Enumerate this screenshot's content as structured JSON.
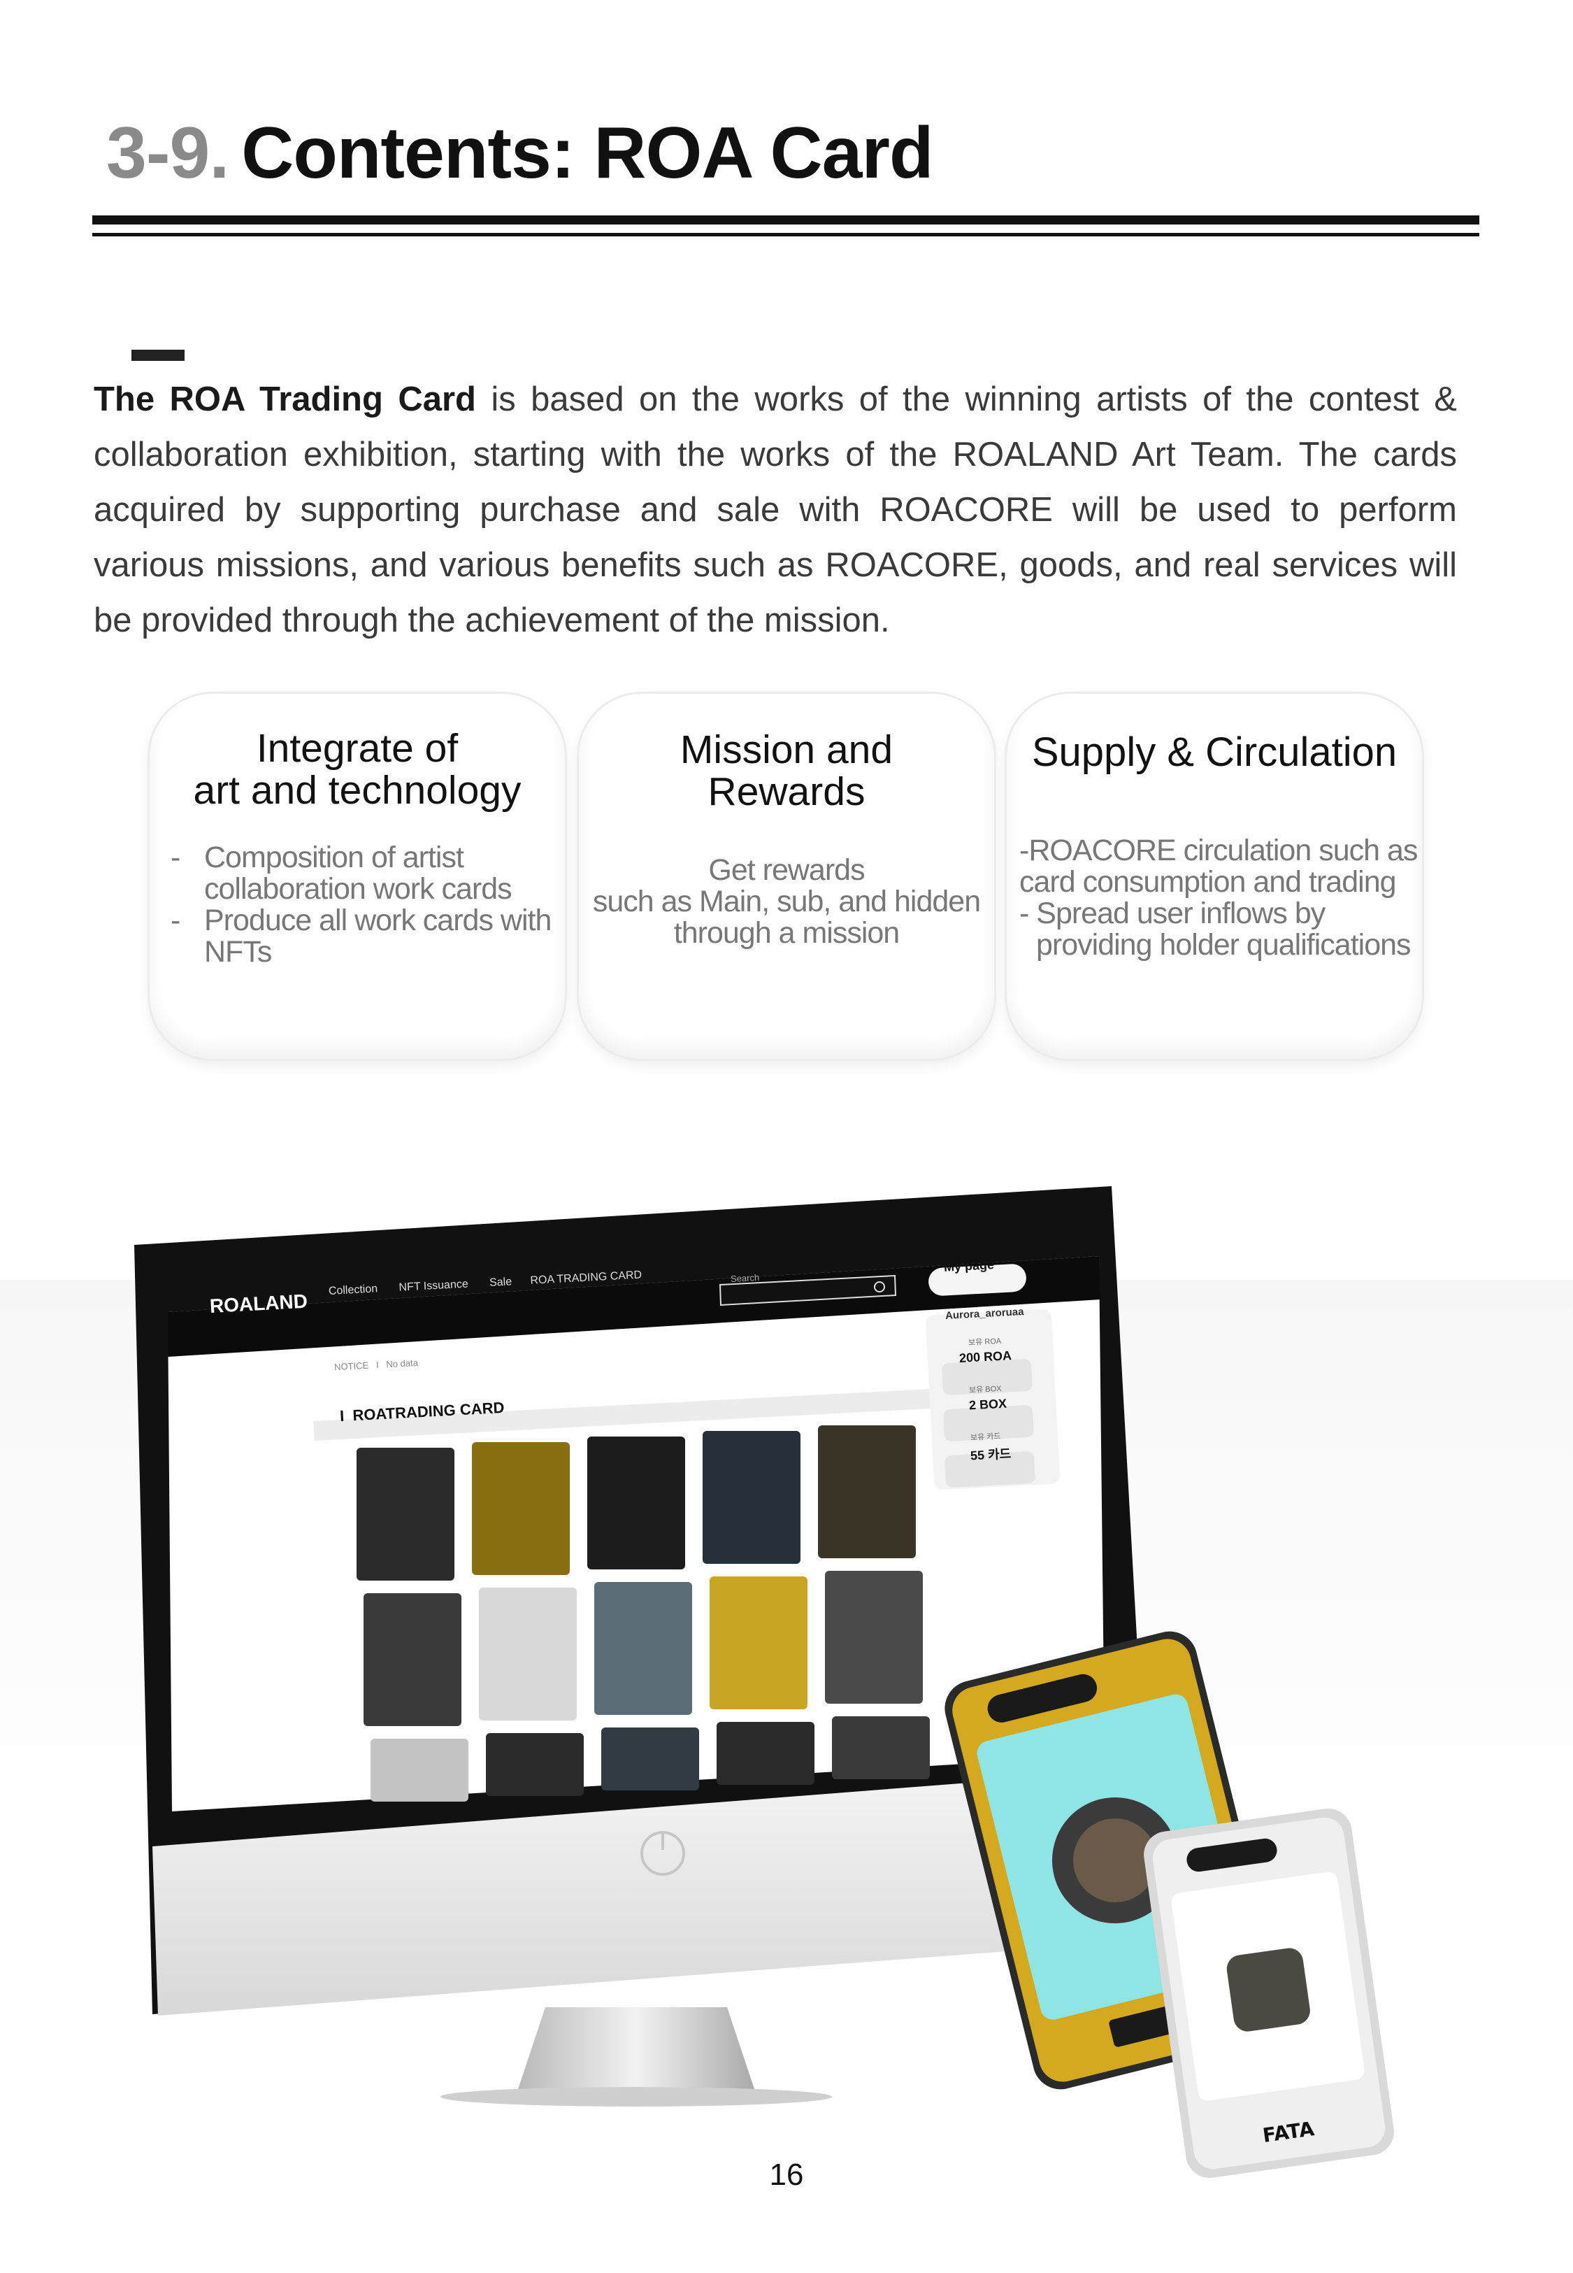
{
  "header": {
    "number": "3-9.",
    "title": "Contents: ROA Card"
  },
  "intro": {
    "lead": "The ROA Trading Card",
    "text": " is based on the works of the winning artists of the contest & collaboration exhibition, starting with the works of the ROALAND Art Team. The cards acquired by supporting purchase and sale with ROACORE will be used to perform various missions, and various benefits such as ROACORE, goods, and real services will be provided through the achievement of the mission."
  },
  "features": [
    {
      "title_line1": "Integrate of",
      "title_line2": "art and technology",
      "items": [
        "Composition of artist collaboration work cards",
        "Produce  all work cards with NFTs"
      ]
    },
    {
      "title_line1": "Mission and",
      "title_line2": "Rewards",
      "text_line1": "Get rewards",
      "text_line2": "such as Main, sub, and hidden",
      "text_line3": "through a mission"
    },
    {
      "title_line1": "Supply & Circulation",
      "line1": "-ROACORE circulation such as",
      "line2": "card consumption and trading",
      "line3": "-    Spread user inflows by",
      "line4": "providing holder qualifications"
    }
  ],
  "screen": {
    "logo": "ROALAND",
    "nav": [
      "Collection",
      "NFT Issuance",
      "Sale",
      "ROA TRADING CARD"
    ],
    "search_placeholder": "Search",
    "mypage_button": "My page",
    "user": "Aurora_aroruaa",
    "stats": [
      {
        "label": "보유 ROA",
        "value": "200 ROA"
      },
      {
        "label": "보유 BOX",
        "value": "2 BOX"
      },
      {
        "label": "보유 카드",
        "value": "55 카드"
      }
    ],
    "notice_label": "NOTICE",
    "notice_text": "No data",
    "section_title": "ROATRADING CARD"
  },
  "card_logo": "FATA",
  "page_number": "16"
}
